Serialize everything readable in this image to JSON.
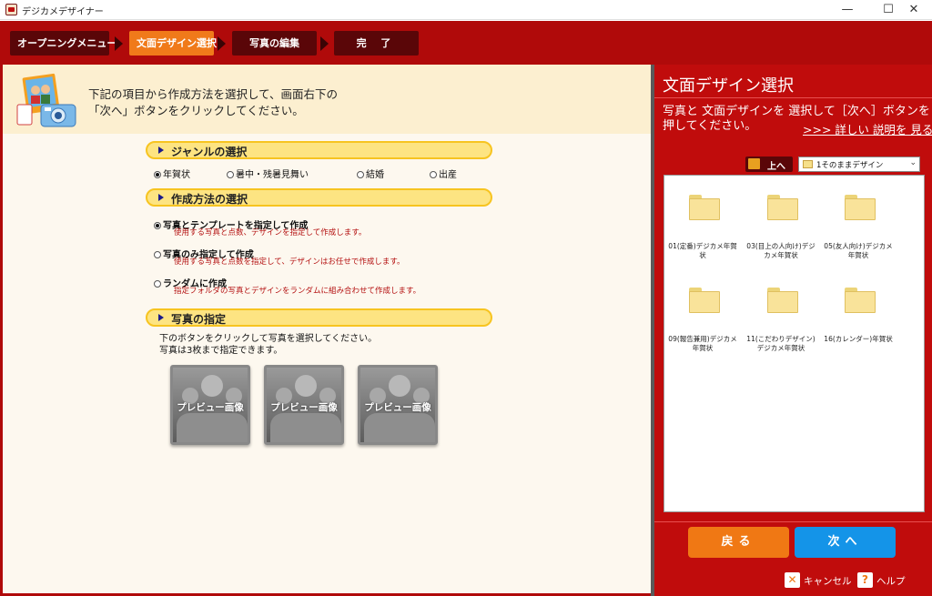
{
  "window": {
    "title": "デジカメデザイナー",
    "controls": [
      "—",
      "☐",
      "✕"
    ]
  },
  "steps": [
    "オープニングメニュー",
    "文面デザイン選択",
    "写真の編集",
    "完 了"
  ],
  "current_step": 1,
  "left": {
    "intro": "下記の項目から作成方法を選択して、画面右下の\n「次へ」ボタンをクリックしてください。",
    "genre": {
      "header": "ジャンルの選択",
      "options": [
        "年賀状",
        "暑中・残暑見舞い",
        "結婚",
        "出産"
      ],
      "selected": 0
    },
    "method": {
      "header": "作成方法の選択",
      "options": [
        {
          "label": "写真とテンプレートを指定して作成",
          "desc": "使用する写真と点数、デザインを指定して作成します。"
        },
        {
          "label": "写真のみ指定して作成",
          "desc": "使用する写真と点数を指定して、デザインはお任せで作成します。"
        },
        {
          "label": "ランダムに作成",
          "desc": "指定フォルダの写真とデザインをランダムに組み合わせて作成します。"
        }
      ],
      "selected": 0
    },
    "photo": {
      "header": "写真の指定",
      "instruction": "下のボタンをクリックして写真を選択してください。\n写真は3枚まで指定できます。",
      "preview_label": "プレビュー画像"
    }
  },
  "right": {
    "title": "文面デザイン選択",
    "description": "写真と 文面デザインを 選択して［次へ］ボタンを\n押してください。",
    "details_link": ">>> 詳しい 説明を 見る",
    "up_button": "上へ",
    "folder_select_value": "1そのままデザイン",
    "folders": [
      "01(定番)デジカメ年賀状",
      "03(目上の人向け)デジカメ年賀状",
      "05(友人向け)デジカメ年賀状",
      "09(報告兼用)デジカメ年賀状",
      "11(こだわりデザイン)デジカメ年賀状",
      "16(カレンダー)年賀状"
    ],
    "back_button": "戻る",
    "next_button": "次へ",
    "cancel_button": "キャンセル",
    "help_button": "ヘルプ"
  },
  "colors": {
    "brand_red": "#c00c0c",
    "active_step": "#f07a1a",
    "back_button": "#f07814",
    "next_button": "#1494e8",
    "section_header": "#fde482"
  }
}
